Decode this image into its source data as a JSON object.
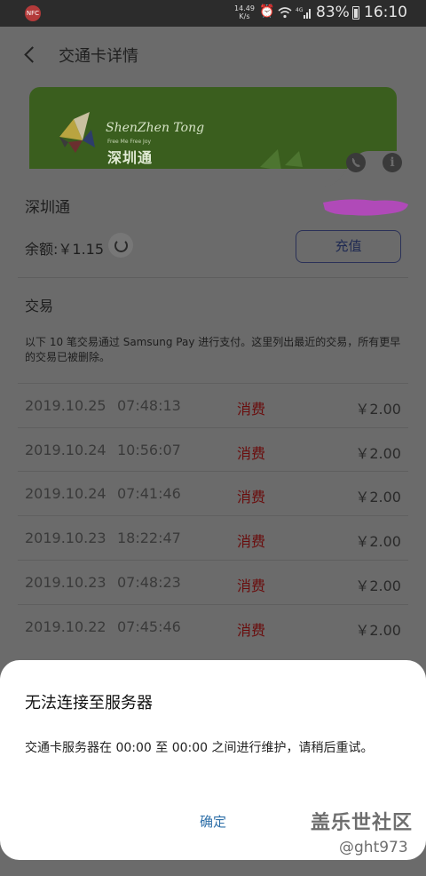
{
  "status_bar": {
    "app_icon_text": "NFC",
    "net_speed_value": "14.49",
    "net_speed_unit": "K/s",
    "icons": [
      "alarm-icon",
      "wifi-icon",
      "signal-4g-icon"
    ],
    "battery_percent": "83%",
    "time": "16:10"
  },
  "header": {
    "title": "交通卡详情"
  },
  "card": {
    "brand": "ShenZhen Tong",
    "slogan": "Free Me Free Joy",
    "brand_cn": "深圳通",
    "color": "#3a5e1e"
  },
  "details": {
    "card_name": "深圳通",
    "balance_label": "余额:￥1.15",
    "recharge_label": "充值"
  },
  "transactions": {
    "section_title": "交易",
    "notice": "以下 10 笔交易通过 Samsung Pay 进行支付。这里列出最近的交易，所有更早的交易已被删除。",
    "rows": [
      {
        "date": "2019.10.25",
        "time": "07:48:13",
        "type": "消费",
        "amount": "￥2.00"
      },
      {
        "date": "2019.10.24",
        "time": "10:56:07",
        "type": "消费",
        "amount": "￥2.00"
      },
      {
        "date": "2019.10.24",
        "time": "07:41:46",
        "type": "消费",
        "amount": "￥2.00"
      },
      {
        "date": "2019.10.23",
        "time": "18:22:47",
        "type": "消费",
        "amount": "￥2.00"
      },
      {
        "date": "2019.10.23",
        "time": "07:48:23",
        "type": "消费",
        "amount": "￥2.00"
      },
      {
        "date": "2019.10.22",
        "time": "07:45:46",
        "type": "消费",
        "amount": "￥2.00"
      }
    ]
  },
  "dialog": {
    "title": "无法连接至服务器",
    "message": "交通卡服务器在 00:00 至 00:00 之间进行维护，请稍后重试。",
    "ok_label": "确定"
  },
  "watermark": {
    "brand": "盖乐世社区",
    "user": "@ght973"
  }
}
